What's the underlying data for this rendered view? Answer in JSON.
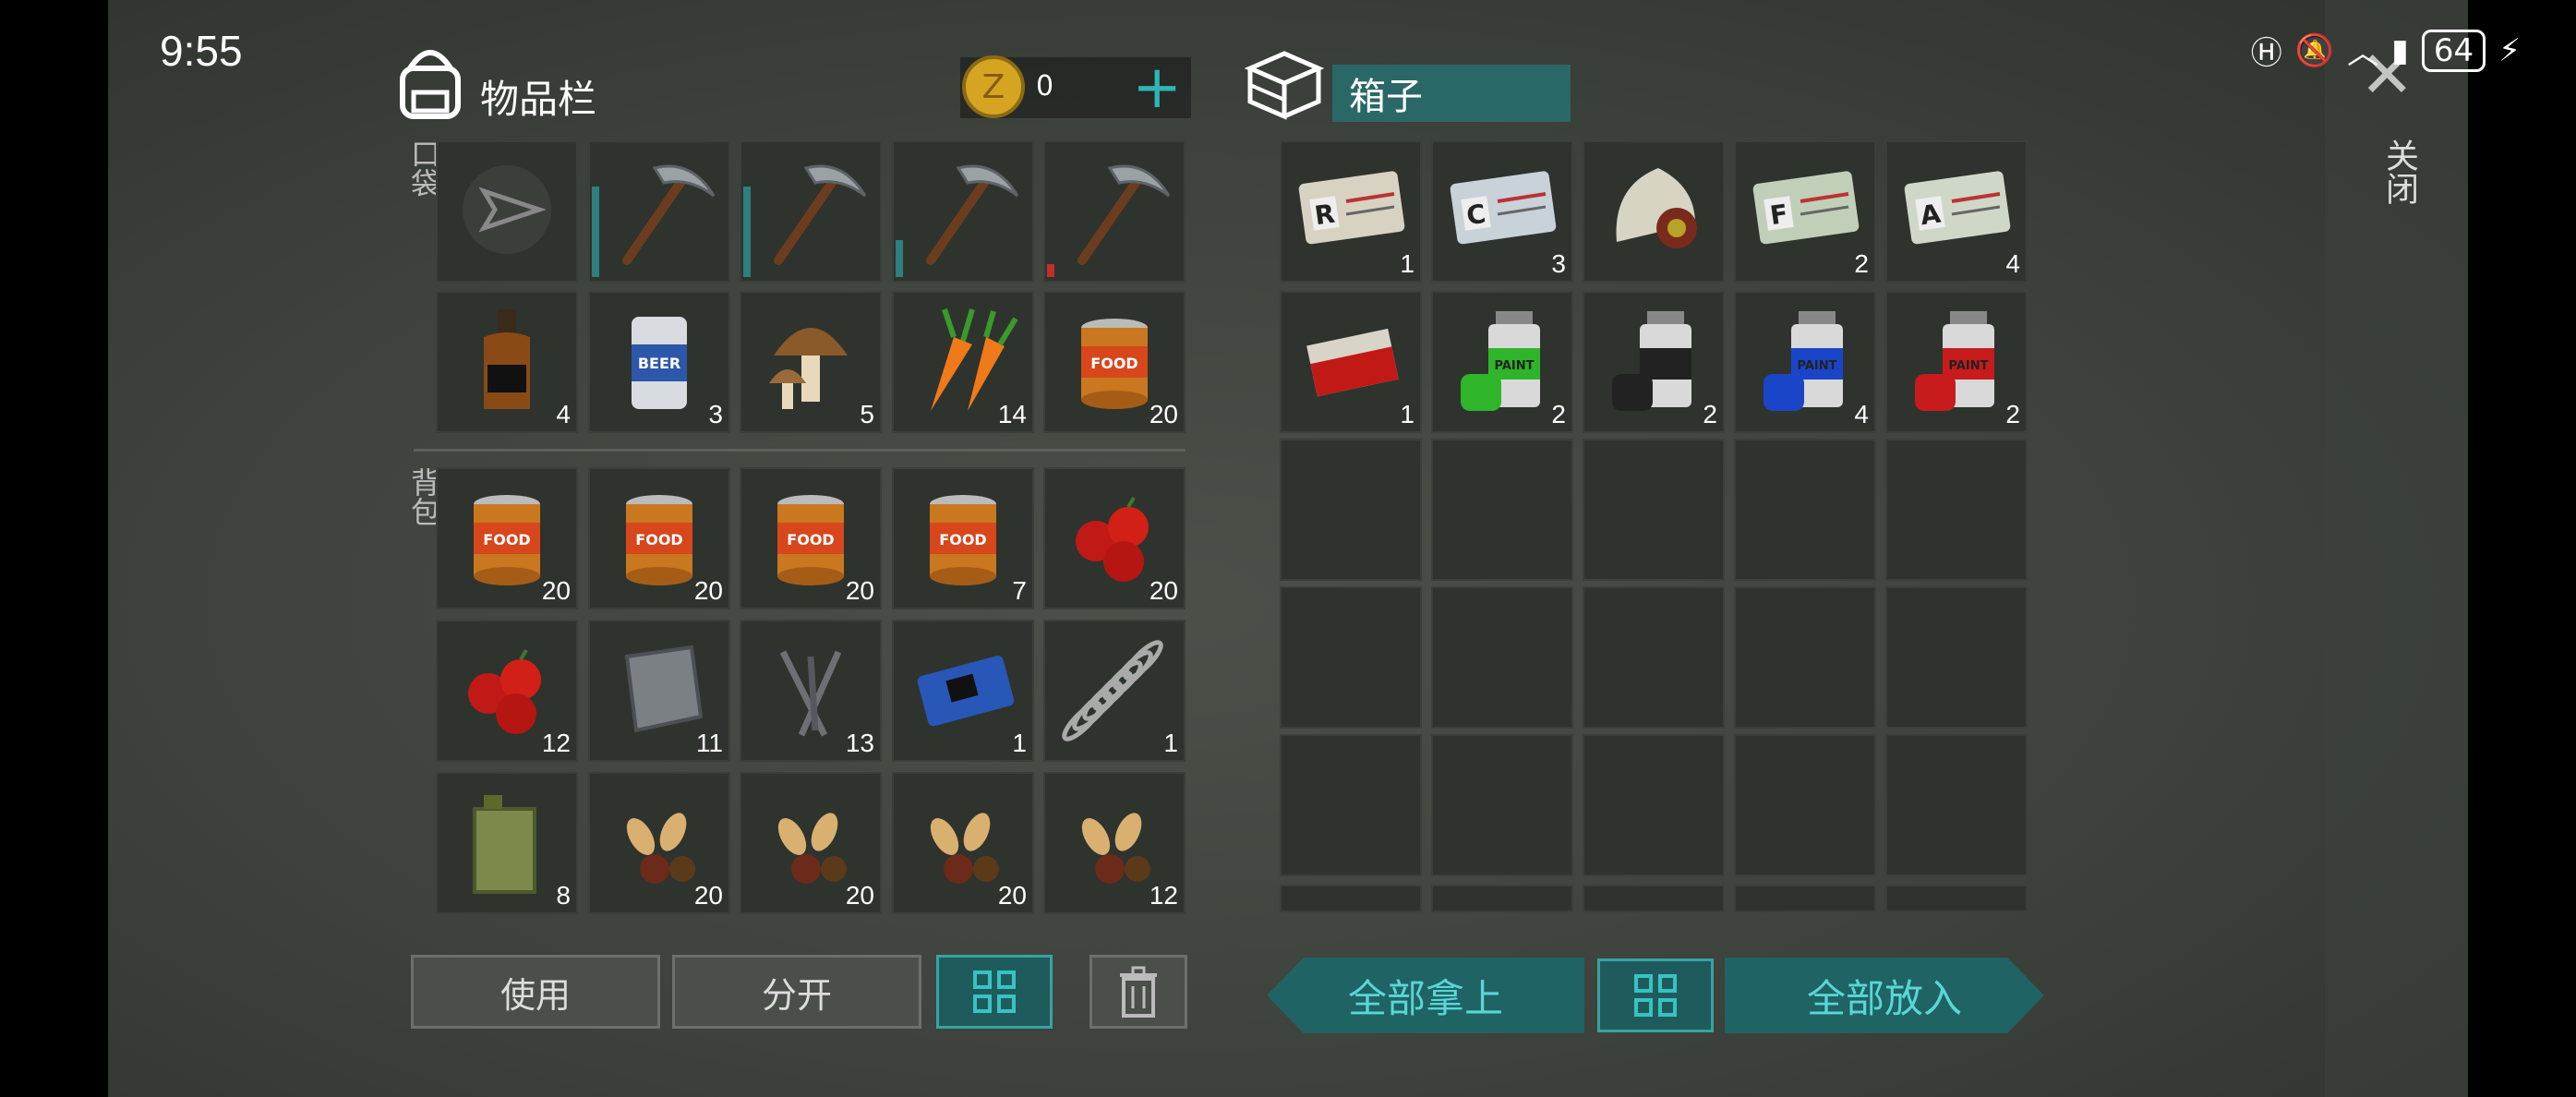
{
  "status": {
    "time": "9:55",
    "battery": "64"
  },
  "inventory": {
    "title": "物品栏",
    "coins": "0",
    "pocket_label": "口袋",
    "backpack_label": "背包",
    "pocket": [
      {
        "icon": "send-icon",
        "count": ""
      },
      {
        "icon": "pickaxe-icon",
        "count": ""
      },
      {
        "icon": "pickaxe-icon",
        "count": ""
      },
      {
        "icon": "pickaxe-icon",
        "count": ""
      },
      {
        "icon": "pickaxe-icon",
        "count": ""
      },
      {
        "icon": "whiskey-icon",
        "count": "4"
      },
      {
        "icon": "beer-can-icon",
        "count": "3"
      },
      {
        "icon": "mushroom-icon",
        "count": "5"
      },
      {
        "icon": "carrot-icon",
        "count": "14"
      },
      {
        "icon": "food-can-icon",
        "count": "20"
      }
    ],
    "backpack": [
      {
        "icon": "food-can-icon",
        "count": "20"
      },
      {
        "icon": "food-can-icon",
        "count": "20"
      },
      {
        "icon": "food-can-icon",
        "count": "20"
      },
      {
        "icon": "food-can-icon",
        "count": "7"
      },
      {
        "icon": "berries-icon",
        "count": "20"
      },
      {
        "icon": "berries-icon",
        "count": "12"
      },
      {
        "icon": "metal-plate-icon",
        "count": "11"
      },
      {
        "icon": "nails-icon",
        "count": "13"
      },
      {
        "icon": "circuit-board-icon",
        "count": "1"
      },
      {
        "icon": "spring-icon",
        "count": "1"
      },
      {
        "icon": "jerrycan-icon",
        "count": "8"
      },
      {
        "icon": "seeds-icon",
        "count": "20"
      },
      {
        "icon": "seeds-icon",
        "count": "20"
      },
      {
        "icon": "seeds-icon",
        "count": "20"
      },
      {
        "icon": "seeds-icon",
        "count": "12"
      }
    ],
    "buttons": {
      "use": "使用",
      "split": "分开"
    }
  },
  "container": {
    "name": "箱子",
    "items": [
      {
        "icon": "card-r-icon",
        "count": "1",
        "letter": "R"
      },
      {
        "icon": "card-c-icon",
        "count": "3",
        "letter": "C"
      },
      {
        "icon": "magazine-icon",
        "count": "",
        "letter": ""
      },
      {
        "icon": "card-f-icon",
        "count": "2",
        "letter": "F"
      },
      {
        "icon": "card-a-icon",
        "count": "4",
        "letter": "A"
      },
      {
        "icon": "cigarettes-icon",
        "count": "1",
        "letter": ""
      },
      {
        "icon": "paint-green-icon",
        "count": "2",
        "letter": ""
      },
      {
        "icon": "paint-black-icon",
        "count": "2",
        "letter": ""
      },
      {
        "icon": "paint-blue-icon",
        "count": "4",
        "letter": ""
      },
      {
        "icon": "paint-red-icon",
        "count": "2",
        "letter": ""
      }
    ],
    "buttons": {
      "take_all": "全部拿上",
      "put_all": "全部放入"
    }
  },
  "close_label": "关闭",
  "colors": {
    "accent": "#37c3c3",
    "slot": "#2e332e"
  }
}
